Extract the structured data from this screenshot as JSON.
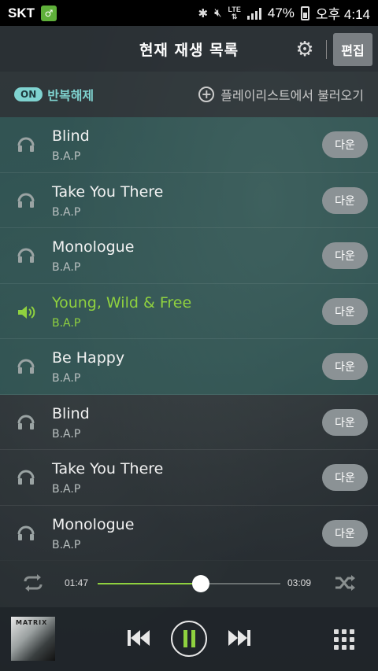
{
  "status_bar": {
    "carrier": "SKT",
    "battery_percent": "47%",
    "time": "오후 4:14",
    "network": "LTE"
  },
  "header": {
    "title": "현재 재생 목록",
    "edit_label": "편집"
  },
  "subbar": {
    "repeat_badge": "ON",
    "repeat_label": "반복해제",
    "load_playlist_label": "플레이리스트에서 불러오기"
  },
  "tracks": [
    {
      "title": "Blind",
      "artist": "B.A.P",
      "button": "다운"
    },
    {
      "title": "Take You There",
      "artist": "B.A.P",
      "button": "다운"
    },
    {
      "title": "Monologue",
      "artist": "B.A.P",
      "button": "다운"
    },
    {
      "title": "Young, Wild & Free",
      "artist": "B.A.P",
      "button": "다운"
    },
    {
      "title": "Be Happy",
      "artist": "B.A.P",
      "button": "다운"
    },
    {
      "title": "Blind",
      "artist": "B.A.P",
      "button": "다운"
    },
    {
      "title": "Take You There",
      "artist": "B.A.P",
      "button": "다운"
    },
    {
      "title": "Monologue",
      "artist": "B.A.P",
      "button": "다운"
    }
  ],
  "playback": {
    "current_time": "01:47",
    "total_time": "03:09",
    "progress_fraction": 0.566
  },
  "album_art": {
    "label": "MATRIX"
  },
  "colors": {
    "accent_green": "#8fd13f",
    "teal_highlight": "#7fd3d0",
    "teal_row": "#2d5f5c"
  }
}
